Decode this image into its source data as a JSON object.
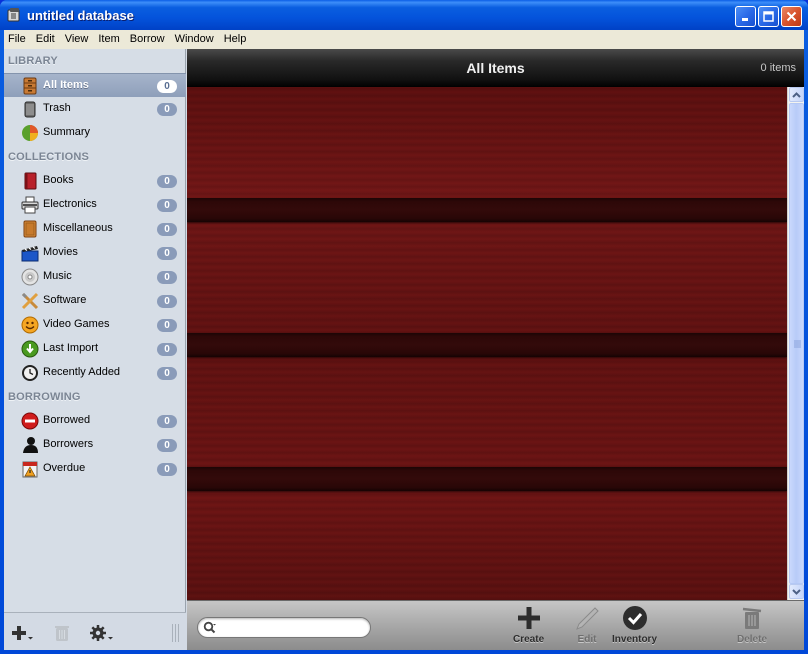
{
  "window": {
    "title": "untitled database",
    "controls": {
      "minimize": "minimize",
      "maximize": "maximize",
      "close": "close"
    }
  },
  "menu": [
    "File",
    "Edit",
    "View",
    "Item",
    "Borrow",
    "Window",
    "Help"
  ],
  "sidebar": {
    "sections": {
      "library": "LIBRARY",
      "collections": "COLLECTIONS",
      "borrowing": "BORROWING"
    },
    "library": [
      {
        "label": "All Items",
        "count": "0",
        "icon": "cabinet-icon",
        "selected": true
      },
      {
        "label": "Trash",
        "count": "0",
        "icon": "trash-icon"
      },
      {
        "label": "Summary",
        "count": null,
        "icon": "pie-chart-icon"
      }
    ],
    "collections": [
      {
        "label": "Books",
        "count": "0",
        "icon": "book-icon"
      },
      {
        "label": "Electronics",
        "count": "0",
        "icon": "printer-icon"
      },
      {
        "label": "Miscellaneous",
        "count": "0",
        "icon": "box-icon"
      },
      {
        "label": "Movies",
        "count": "0",
        "icon": "clapperboard-icon"
      },
      {
        "label": "Music",
        "count": "0",
        "icon": "cd-icon"
      },
      {
        "label": "Software",
        "count": "0",
        "icon": "tools-icon"
      },
      {
        "label": "Video Games",
        "count": "0",
        "icon": "smiley-icon"
      },
      {
        "label": "Last Import",
        "count": "0",
        "icon": "import-arrow-icon"
      },
      {
        "label": "Recently Added",
        "count": "0",
        "icon": "clock-icon"
      }
    ],
    "borrowing": [
      {
        "label": "Borrowed",
        "count": "0",
        "icon": "no-entry-icon"
      },
      {
        "label": "Borrowers",
        "count": "0",
        "icon": "person-icon"
      },
      {
        "label": "Overdue",
        "count": "0",
        "icon": "calendar-warning-icon"
      }
    ],
    "footer": {
      "add": "add-collection",
      "delete": "delete-collection",
      "settings": "settings"
    }
  },
  "main": {
    "title": "All Items",
    "item_count": "0 items",
    "search": {
      "value": "",
      "placeholder": ""
    },
    "toolbar": {
      "create": "Create",
      "edit": "Edit",
      "inventory": "Inventory",
      "delete": "Delete"
    }
  },
  "colors": {
    "titlebar": "#0a5ee0",
    "sidebar_bg": "#d6dde6",
    "selected_row": "#95a5c0",
    "badge": "#8a9bb9",
    "shelf_wood": "#6a1414",
    "header_bg": "#1a1a1a"
  }
}
